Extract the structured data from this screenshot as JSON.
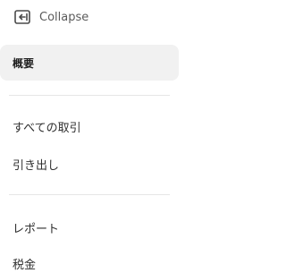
{
  "sidebar": {
    "collapse_label": "Collapse",
    "overview_label": "概要",
    "items": [
      {
        "label": "すべての取引"
      },
      {
        "label": "引き出し"
      },
      {
        "label": "レポート"
      },
      {
        "label": "税金"
      }
    ]
  }
}
